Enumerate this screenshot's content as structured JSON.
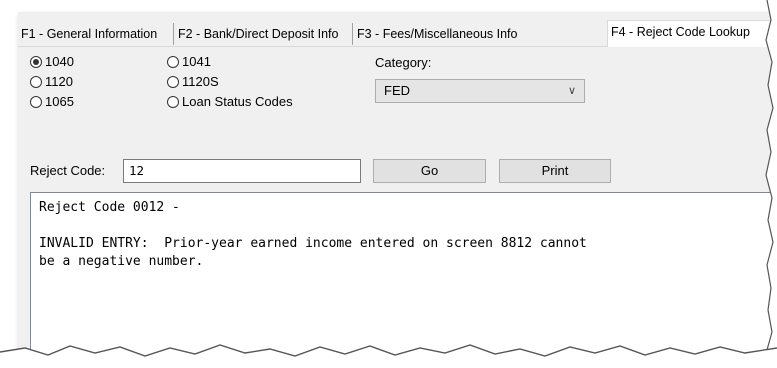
{
  "tabs": [
    {
      "label": "F1 - General Information"
    },
    {
      "label": "F2 - Bank/Direct Deposit Info"
    },
    {
      "label": "F3 - Fees/Miscellaneous Info"
    },
    {
      "label": "F4 - Reject Code Lookup"
    }
  ],
  "form_types": [
    {
      "label": "1040",
      "checked": true
    },
    {
      "label": "1120",
      "checked": false
    },
    {
      "label": "1065",
      "checked": false
    },
    {
      "label": "1041",
      "checked": false
    },
    {
      "label": "1120S",
      "checked": false
    },
    {
      "label": "Loan Status Codes",
      "checked": false
    }
  ],
  "category": {
    "label": "Category:",
    "value": "FED"
  },
  "reject_code": {
    "label": "Reject Code:",
    "value": "12"
  },
  "buttons": {
    "go": "Go",
    "print": "Print"
  },
  "result": {
    "line1": "Reject Code 0012 -",
    "line2": "INVALID ENTRY:  Prior-year earned income entered on screen 8812 cannot",
    "line3": "be a negative number."
  }
}
